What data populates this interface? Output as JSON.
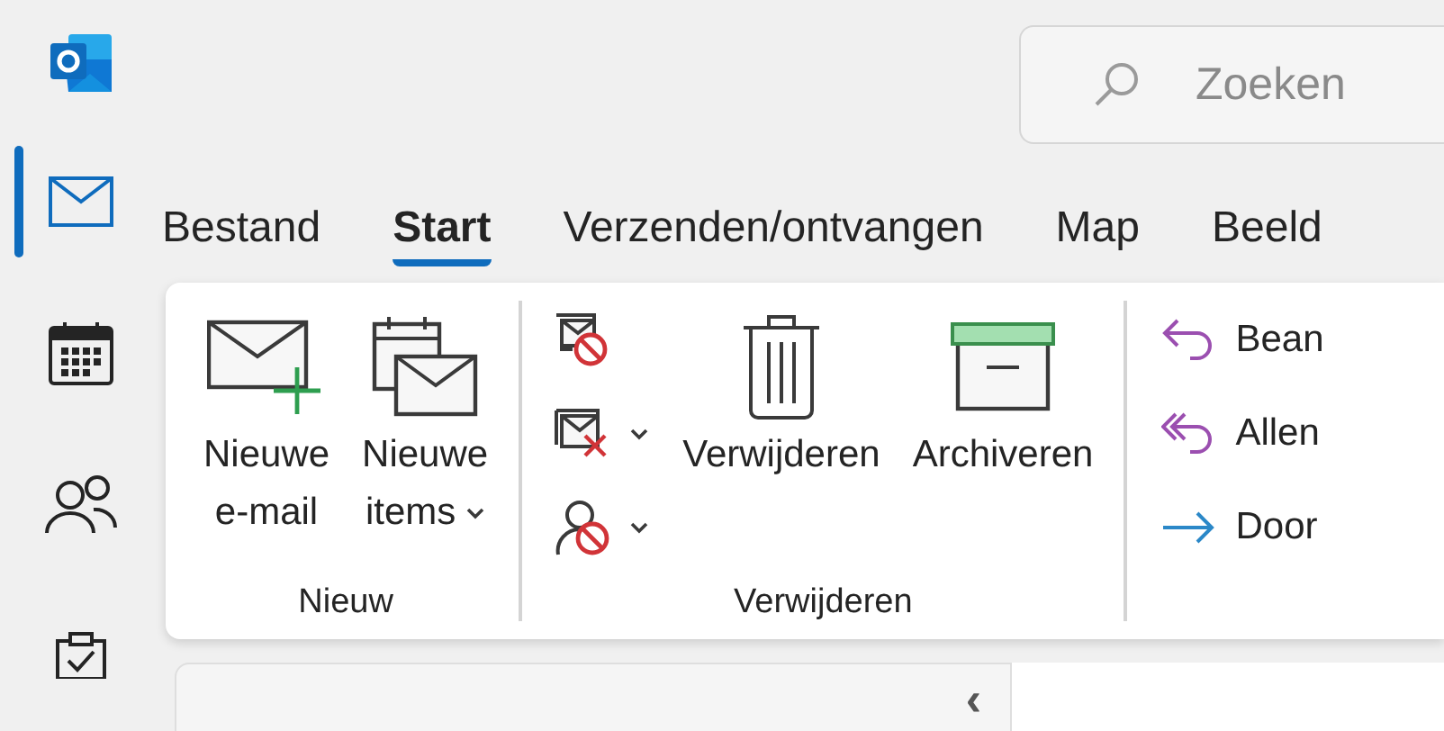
{
  "search": {
    "placeholder": "Zoeken"
  },
  "nav_rail": [
    {
      "kind": "mail",
      "selected": true
    },
    {
      "kind": "calendar",
      "selected": false
    },
    {
      "kind": "people",
      "selected": false
    },
    {
      "kind": "tasks",
      "selected": false
    }
  ],
  "tabs": [
    {
      "label": "Bestand",
      "selected": false
    },
    {
      "label": "Start",
      "selected": true
    },
    {
      "label": "Verzenden/ontvangen",
      "selected": false
    },
    {
      "label": "Map",
      "selected": false
    },
    {
      "label": "Beeld",
      "selected": false
    }
  ],
  "ribbon": {
    "groups": [
      {
        "label": "Nieuw",
        "columns": [
          {
            "kind": "large",
            "label_lines": [
              "Nieuwe",
              "e-mail"
            ],
            "dropdown": false
          },
          {
            "kind": "large",
            "label_lines": [
              "Nieuwe",
              "items"
            ],
            "dropdown": true
          }
        ]
      },
      {
        "label": "Verwijderen",
        "columns": [
          {
            "kind": "stack",
            "items": [
              {
                "dropdown": false
              },
              {
                "dropdown": true
              },
              {
                "dropdown": true
              }
            ]
          },
          {
            "kind": "large",
            "label_lines": [
              "Verwijderen"
            ],
            "dropdown": false
          },
          {
            "kind": "large",
            "label_lines": [
              "Archiveren"
            ],
            "dropdown": false
          }
        ]
      },
      {
        "columns": [
          {
            "kind": "stack",
            "items": [
              {
                "label": "Bean",
                "dropdown": false
              },
              {
                "label": "Allen",
                "dropdown": false
              },
              {
                "label": "Door",
                "dropdown": false
              }
            ]
          }
        ]
      }
    ]
  },
  "folder_pane": {
    "collapse_glyph": "‹"
  }
}
